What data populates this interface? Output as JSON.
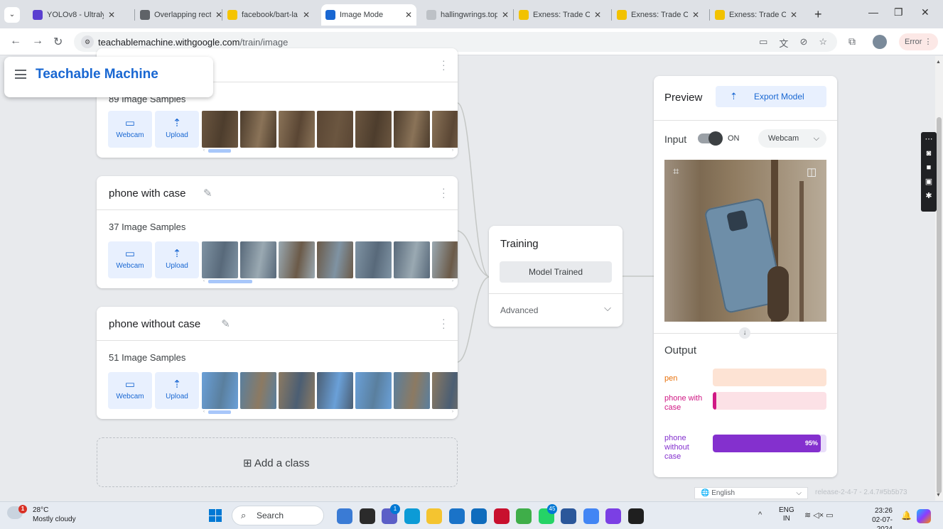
{
  "browser": {
    "tabs": [
      {
        "title": "YOLOv8 - Ultraly",
        "icon": "ultralytics-icon",
        "color": "#5b3fd0"
      },
      {
        "title": "Overlapping rect",
        "icon": "infinity-icon",
        "color": "#5f6368"
      },
      {
        "title": "facebook/bart-la",
        "icon": "huggingface-icon",
        "color": "#f5c400"
      },
      {
        "title": "Image Mode",
        "icon": "tm-icon",
        "color": "#1967d2",
        "active": true
      },
      {
        "title": "hallingwrings.top",
        "icon": "page-icon",
        "color": "#bdc1c6"
      },
      {
        "title": "Exness: Trade On",
        "icon": "exness-icon",
        "color": "#f2c200"
      },
      {
        "title": "Exness: Trade On",
        "icon": "exness-icon",
        "color": "#f2c200"
      },
      {
        "title": "Exness: Trade On",
        "icon": "exness-icon",
        "color": "#f2c200"
      }
    ],
    "new_tab": "+",
    "address": {
      "domain": "teachablemachine.withgoogle.com",
      "path": "/train/image"
    },
    "error_label": "Error"
  },
  "app": {
    "brand": "Teachable Machine",
    "accent": "#1967d2",
    "classes": [
      {
        "name": "",
        "samples_label": "89 Image Samples",
        "photo_tone": "wood"
      },
      {
        "name": "phone with case",
        "samples_label": "37 Image Samples",
        "photo_tone": "case"
      },
      {
        "name": "phone without case",
        "samples_label": "51 Image Samples",
        "photo_tone": "bare"
      }
    ],
    "webcam_label": "Webcam",
    "upload_label": "Upload",
    "add_class_label": "Add a class",
    "training": {
      "title": "Training",
      "button_label": "Model Trained",
      "advanced_label": "Advanced"
    },
    "preview": {
      "title": "Preview",
      "export_label": "Export Model",
      "input_label": "Input",
      "toggle_state": "ON",
      "source_label": "Webcam",
      "output_title": "Output",
      "outputs": [
        {
          "label": "pen",
          "value": 0.0,
          "pct_text": "",
          "color": "#e8710a",
          "track": "#fde3d4"
        },
        {
          "label": "phone with case",
          "value": 0.03,
          "pct_text": "",
          "color": "#d01884",
          "track": "#fce1e6"
        },
        {
          "label": "phone without case",
          "value": 0.95,
          "pct_text": "95%",
          "color": "#8430ce",
          "track": "#e9defa"
        }
      ]
    },
    "footer": {
      "language": "English",
      "release": "release-2-4-7 - 2.4.7#5b5b73"
    }
  },
  "taskbar": {
    "weather_temp": "28°C",
    "weather_condition": "Mostly cloudy",
    "weather_badge": "1",
    "search_label": "Search",
    "apps": [
      {
        "name": "gallery-app",
        "color": "#3a7bd5"
      },
      {
        "name": "task-view-app",
        "color": "#2b2b2b"
      },
      {
        "name": "teams-app",
        "color": "#5b5fc7",
        "badge": "1"
      },
      {
        "name": "edge-app",
        "color": "#0c9bd6"
      },
      {
        "name": "file-explorer-app",
        "color": "#f4c430"
      },
      {
        "name": "mail-app",
        "color": "#1a73c8"
      },
      {
        "name": "outlook-app",
        "color": "#0f6cbd"
      },
      {
        "name": "mcafee-app",
        "color": "#c8102e"
      },
      {
        "name": "copilot-app",
        "color": "#3fae49"
      },
      {
        "name": "whatsapp-app",
        "color": "#25d366",
        "badge": "45"
      },
      {
        "name": "word-app",
        "color": "#2b579a"
      },
      {
        "name": "chrome-app",
        "color": "#4285f4"
      },
      {
        "name": "stack-app",
        "color": "#7b3fe4"
      },
      {
        "name": "media-app",
        "color": "#1f1f1f"
      }
    ],
    "lang_top": "ENG",
    "lang_bottom": "IN",
    "time": "23:26",
    "date": "02-07-2024"
  }
}
